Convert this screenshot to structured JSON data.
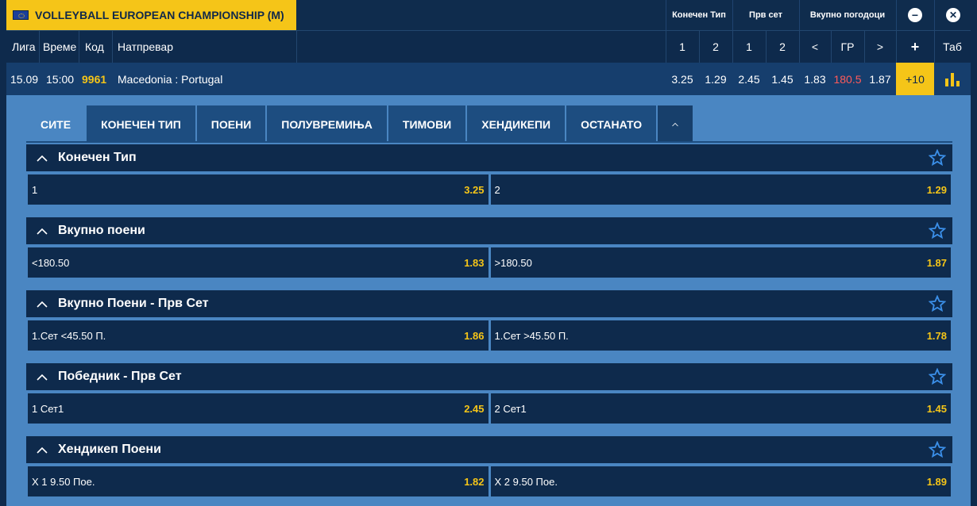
{
  "header": {
    "league_title": "VOLLEYBALL EUROPEAN CHAMPIONSHIP (M)",
    "col_groups": [
      "Конечен Тип",
      "Прв сет",
      "Вкупно погодоци"
    ],
    "minimize_icon": "minus-circle-icon",
    "close_icon": "close-circle-icon"
  },
  "columns": {
    "league": "Лига",
    "time": "Време",
    "code": "Код",
    "match": "Натпревар",
    "ft1": "1",
    "ft2": "2",
    "s1": "1",
    "s2": "2",
    "lt": "<",
    "gr": "ГР",
    "gt": ">",
    "plus": "+",
    "tab": "Таб"
  },
  "match": {
    "date": "15.09",
    "time": "15:00",
    "code": "9961",
    "name": "Macedonia : Portugal",
    "ft1": "3.25",
    "ft2": "1.29",
    "s1": "2.45",
    "s2": "1.45",
    "under": "1.83",
    "line": "180.5",
    "over": "1.87",
    "more": "+10",
    "stats_icon": "bar-chart-icon"
  },
  "tabs": [
    "СИТЕ",
    "КОНЕЧЕН ТИП",
    "ПОЕНИ",
    "ПОЛУВРЕМИЊА",
    "ТИМОВИ",
    "ХЕНДИКЕПИ",
    "ОСТАНАТО"
  ],
  "sections": [
    {
      "title": "Конечен Тип",
      "left": {
        "label": "1",
        "odd": "3.25"
      },
      "right": {
        "label": "2",
        "odd": "1.29"
      }
    },
    {
      "title": "Вкупно поени",
      "left": {
        "label": "<180.50",
        "odd": "1.83"
      },
      "right": {
        "label": ">180.50",
        "odd": "1.87"
      }
    },
    {
      "title": "Вкупно Поени - Прв Сет",
      "left": {
        "label": "1.Сет <45.50 П.",
        "odd": "1.86"
      },
      "right": {
        "label": "1.Сет >45.50 П.",
        "odd": "1.78"
      }
    },
    {
      "title": "Победник - Прв Сет",
      "left": {
        "label": "1 Сет1",
        "odd": "2.45"
      },
      "right": {
        "label": "2 Сет1",
        "odd": "1.45"
      }
    },
    {
      "title": "Хендикеп Поени",
      "left": {
        "label": "Х 1 9.50 Пое.",
        "odd": "1.82"
      },
      "right": {
        "label": "Х 2 9.50 Пое.",
        "odd": "1.89"
      }
    }
  ],
  "colors": {
    "accent": "#f5c518",
    "dark": "#0e2a4c",
    "panel": "#4a86c2",
    "line_red": "#ff5a5a",
    "star": "#3b8fe8"
  }
}
